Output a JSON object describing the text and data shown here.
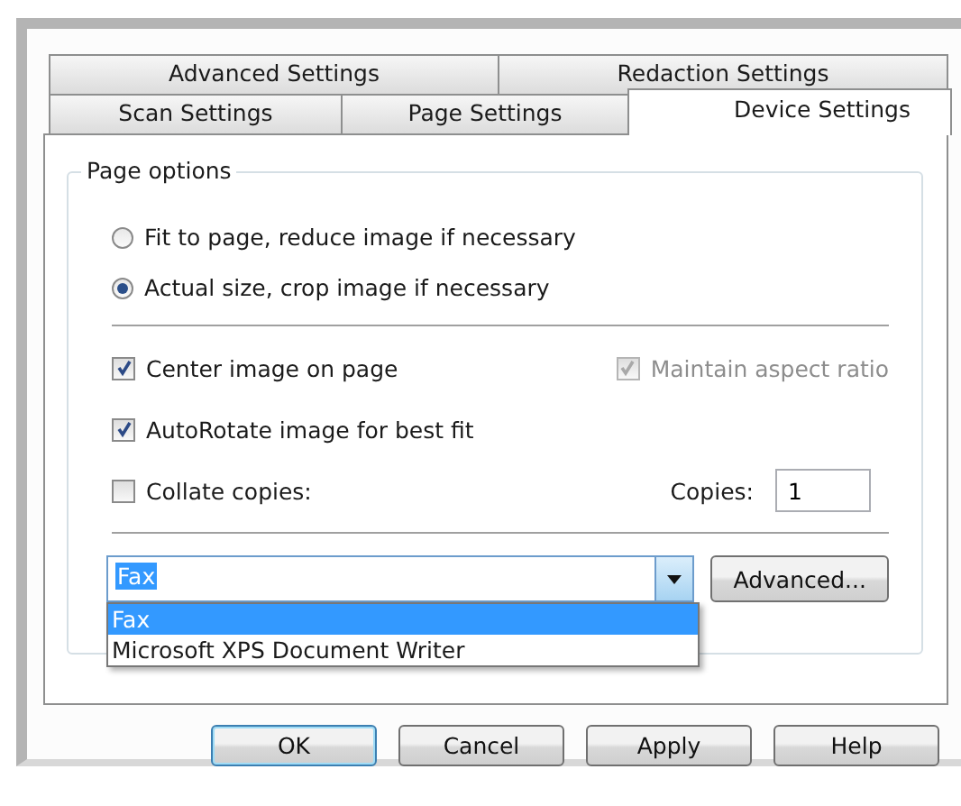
{
  "tab_rows": [
    [
      {
        "label": "Advanced Settings",
        "selected": false
      },
      {
        "label": "Redaction Settings",
        "selected": false
      }
    ],
    [
      {
        "label": "Scan Settings",
        "selected": false
      },
      {
        "label": "Page Settings",
        "selected": false
      },
      {
        "label": "Device Settings",
        "selected": true
      }
    ]
  ],
  "page_options": {
    "title": "Page options",
    "radio_options": [
      {
        "label": "Fit to page, reduce image if necessary",
        "selected": false
      },
      {
        "label": "Actual size, crop image if necessary",
        "selected": true
      }
    ],
    "checkbox_rows": [
      {
        "checkboxes": [
          {
            "label": "Center image on page",
            "checked": true,
            "disabled": false
          },
          {
            "label": "Maintain aspect ratio",
            "checked": true,
            "disabled": true
          }
        ]
      },
      {
        "checkboxes": [
          {
            "label": "AutoRotate image for best fit",
            "checked": true,
            "disabled": false
          }
        ]
      },
      {
        "checkboxes": [
          {
            "label": "Collate copies:",
            "checked": false,
            "disabled": false
          }
        ],
        "copies": {
          "label": "Copies:",
          "value": "1"
        }
      }
    ],
    "device_combo": {
      "value": "Fax",
      "expanded": true,
      "options": [
        {
          "label": "Fax",
          "selected": true
        },
        {
          "label": "Microsoft XPS Document Writer",
          "selected": false
        }
      ]
    },
    "advanced_button": "Advanced..."
  },
  "buttons": [
    {
      "label": "OK",
      "focused": true
    },
    {
      "label": "Cancel",
      "focused": false
    },
    {
      "label": "Apply",
      "focused": false
    },
    {
      "label": "Help",
      "focused": false
    }
  ]
}
